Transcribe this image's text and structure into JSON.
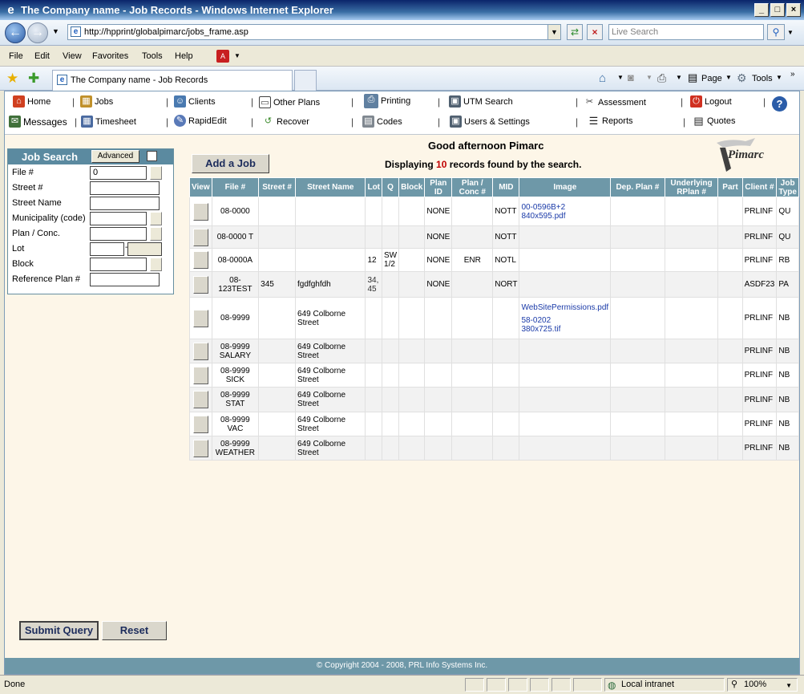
{
  "window": {
    "title": "The Company name - Job Records - Windows Internet Explorer"
  },
  "browser": {
    "url": "http://hpprint/globalpimarc/jobs_frame.asp",
    "search_placeholder": "Live Search",
    "menu": [
      "File",
      "Edit",
      "View",
      "Favorites",
      "Tools",
      "Help"
    ],
    "tab_title": "The Company name - Job Records",
    "cmd": {
      "page": "Page",
      "tools": "Tools"
    },
    "status": {
      "left": "Done",
      "zone": "Local intranet",
      "zoom": "100%"
    }
  },
  "appnav": {
    "row1": [
      {
        "label": "Home",
        "icon": "home-icon"
      },
      {
        "label": "Jobs",
        "icon": "jobs-icon"
      },
      {
        "label": "Clients",
        "icon": "clients-icon"
      },
      {
        "label": "Other Plans",
        "icon": "other-plans-icon"
      },
      {
        "label": "Printing",
        "icon": "printer-icon"
      },
      {
        "label": "UTM Search",
        "icon": "utm-search-icon"
      },
      {
        "label": "Assessment",
        "icon": "assessment-icon"
      },
      {
        "label": "Logout",
        "icon": "logout-icon"
      }
    ],
    "row2": [
      {
        "label": "Messages",
        "icon": "messages-icon"
      },
      {
        "label": "Timesheet",
        "icon": "timesheet-icon"
      },
      {
        "label": "RapidEdit",
        "icon": "rapidedit-icon"
      },
      {
        "label": "Recover",
        "icon": "recover-icon"
      },
      {
        "label": "Codes",
        "icon": "codes-icon"
      },
      {
        "label": "Users & Settings",
        "icon": "users-settings-icon"
      },
      {
        "label": "Reports",
        "icon": "reports-icon"
      },
      {
        "label": "Quotes",
        "icon": "quotes-icon"
      }
    ],
    "help_icon": "help-icon"
  },
  "search": {
    "title": "Job Search",
    "advanced_label": "Advanced",
    "fields": [
      {
        "label": "File #",
        "value": "0"
      },
      {
        "label": "Street #",
        "value": ""
      },
      {
        "label": "Street Name",
        "value": ""
      },
      {
        "label": "Municipality (code)",
        "value": ""
      },
      {
        "label": "Plan / Conc.",
        "value": ""
      },
      {
        "label": "Lot",
        "value": ""
      },
      {
        "label": "Block",
        "value": ""
      },
      {
        "label": "Reference Plan #",
        "value": ""
      }
    ],
    "lot_separator": "-",
    "submit_label": "Submit Query",
    "reset_label": "Reset"
  },
  "main": {
    "greeting": "Good afternoon Pimarc",
    "displaying_prefix": "Displaying",
    "count": "10",
    "displaying_suffix": "records found by the search.",
    "add_job_label": "Add a Job",
    "logo_text": "Pimarc"
  },
  "table": {
    "headers": [
      "View",
      "File #",
      "Street #",
      "Street Name",
      "Lot",
      "Q",
      "Block",
      "Plan ID",
      "Plan / Conc #",
      "MID",
      "Image",
      "Dep. Plan #",
      "Underlying RPlan #",
      "Part",
      "Client #",
      "Job Type"
    ],
    "rows": [
      {
        "file": "08-0000",
        "street_no": "",
        "street_name": "",
        "lot": "",
        "q": "",
        "block": "",
        "plan_id": "NONE",
        "plan_conc": "",
        "mid": "NOTT",
        "image": [
          "00-0596B+2",
          "840x595.pdf"
        ],
        "dep_plan": "",
        "urplan": "",
        "part": "",
        "client": "PRLINF",
        "job_type": "QU"
      },
      {
        "file": "08-0000 T",
        "street_no": "",
        "street_name": "",
        "lot": "",
        "q": "",
        "block": "",
        "plan_id": "NONE",
        "plan_conc": "",
        "mid": "NOTT",
        "image": [],
        "dep_plan": "",
        "urplan": "",
        "part": "",
        "client": "PRLINF",
        "job_type": "QU"
      },
      {
        "file": "08-0000A",
        "street_no": "",
        "street_name": "",
        "lot": "12",
        "q": "SW 1/2",
        "block": "",
        "plan_id": "NONE",
        "plan_conc": "ENR",
        "mid": "NOTL",
        "image": [],
        "dep_plan": "",
        "urplan": "",
        "part": "",
        "client": "PRLINF",
        "job_type": "RB"
      },
      {
        "file": "08-123TEST",
        "street_no": "345",
        "street_name": "fgdfghfdh",
        "lot": "34, 45",
        "q": "",
        "block": "",
        "plan_id": "NONE",
        "plan_conc": "",
        "mid": "NORT",
        "image": [],
        "dep_plan": "",
        "urplan": "",
        "part": "",
        "client": "ASDF23",
        "job_type": "PA"
      },
      {
        "file": "08-9999",
        "street_no": "",
        "street_name": "649 Colborne Street",
        "lot": "",
        "q": "",
        "block": "",
        "plan_id": "",
        "plan_conc": "",
        "mid": "",
        "image": [
          "WebSitePermissions.pdf",
          "58-0202",
          "380x725.tif"
        ],
        "dep_plan": "",
        "urplan": "",
        "part": "",
        "client": "PRLINF",
        "job_type": "NB"
      },
      {
        "file": "08-9999 SALARY",
        "street_no": "",
        "street_name": "649 Colborne Street",
        "lot": "",
        "q": "",
        "block": "",
        "plan_id": "",
        "plan_conc": "",
        "mid": "",
        "image": [],
        "dep_plan": "",
        "urplan": "",
        "part": "",
        "client": "PRLINF",
        "job_type": "NB"
      },
      {
        "file": "08-9999 SICK",
        "street_no": "",
        "street_name": "649 Colborne Street",
        "lot": "",
        "q": "",
        "block": "",
        "plan_id": "",
        "plan_conc": "",
        "mid": "",
        "image": [],
        "dep_plan": "",
        "urplan": "",
        "part": "",
        "client": "PRLINF",
        "job_type": "NB"
      },
      {
        "file": "08-9999 STAT",
        "street_no": "",
        "street_name": "649 Colborne Street",
        "lot": "",
        "q": "",
        "block": "",
        "plan_id": "",
        "plan_conc": "",
        "mid": "",
        "image": [],
        "dep_plan": "",
        "urplan": "",
        "part": "",
        "client": "PRLINF",
        "job_type": "NB"
      },
      {
        "file": "08-9999 VAC",
        "street_no": "",
        "street_name": "649 Colborne Street",
        "lot": "",
        "q": "",
        "block": "",
        "plan_id": "",
        "plan_conc": "",
        "mid": "",
        "image": [],
        "dep_plan": "",
        "urplan": "",
        "part": "",
        "client": "PRLINF",
        "job_type": "NB"
      },
      {
        "file": "08-9999 WEATHER",
        "street_no": "",
        "street_name": "649 Colborne Street",
        "lot": "",
        "q": "",
        "block": "",
        "plan_id": "",
        "plan_conc": "",
        "mid": "",
        "image": [],
        "dep_plan": "",
        "urplan": "",
        "part": "",
        "client": "PRLINF",
        "job_type": "NB"
      }
    ]
  },
  "footer": {
    "copyright": "© Copyright 2004 - 2008, PRL Info Systems Inc."
  }
}
